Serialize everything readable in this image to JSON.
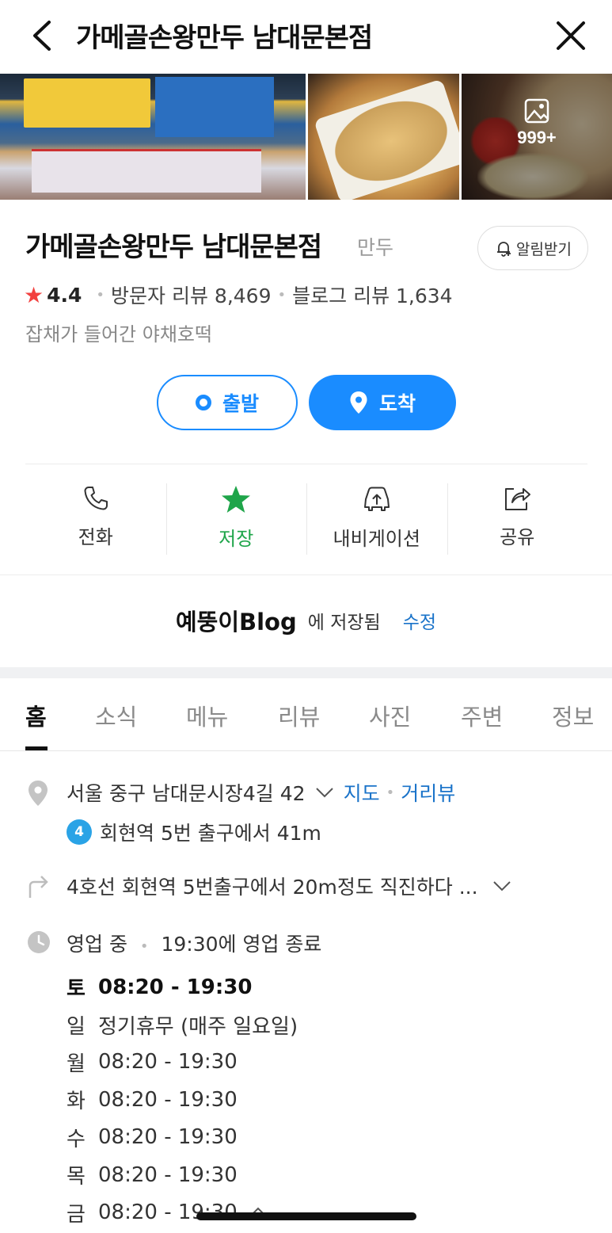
{
  "header": {
    "title": "가메골손왕만두 남대문본점"
  },
  "photos": {
    "count_label": "999+"
  },
  "place": {
    "name": "가메골손왕만두 남대문본점",
    "category": "만두",
    "alert_label": "알림받기",
    "rating": "4.4",
    "visitor_reviews": "방문자 리뷰 8,469",
    "blog_reviews": "블로그 리뷰 1,634",
    "description": "잡채가 들어간 야채호떡"
  },
  "directions_buttons": {
    "start": "출발",
    "arrive": "도착"
  },
  "actions": [
    {
      "label": "전화",
      "icon": "phone-icon"
    },
    {
      "label": "저장",
      "icon": "star-icon"
    },
    {
      "label": "내비게이션",
      "icon": "car-icon"
    },
    {
      "label": "공유",
      "icon": "share-icon"
    }
  ],
  "saved": {
    "list_name": "예뚱이Blog",
    "suffix": "에 저장됨",
    "edit": "수정"
  },
  "tabs": [
    "홈",
    "소식",
    "메뉴",
    "리뷰",
    "사진",
    "주변",
    "정보"
  ],
  "info": {
    "address": "서울 중구 남대문시장4길 42",
    "map_link": "지도",
    "street_view_link": "거리뷰",
    "subway_line": "4",
    "subway_text": "회현역 5번 출구에서 41m",
    "directions_text": "4호선 회현역 5번출구에서 20m정도 직진하다 ...",
    "status": "영업 중",
    "closing": "19:30에 영업 종료"
  },
  "hours": [
    {
      "day": "토",
      "time": "08:20 - 19:30"
    },
    {
      "day": "일",
      "time": "정기휴무 (매주 일요일)"
    },
    {
      "day": "월",
      "time": "08:20 - 19:30"
    },
    {
      "day": "화",
      "time": "08:20 - 19:30"
    },
    {
      "day": "수",
      "time": "08:20 - 19:30"
    },
    {
      "day": "목",
      "time": "08:20 - 19:30"
    },
    {
      "day": "금",
      "time": "08:20 - 19:30"
    }
  ],
  "colors": {
    "accent_blue": "#1a8cff",
    "saved_green": "#1fa54a",
    "star_red": "#f2413f",
    "link_blue": "#1a73c9"
  }
}
